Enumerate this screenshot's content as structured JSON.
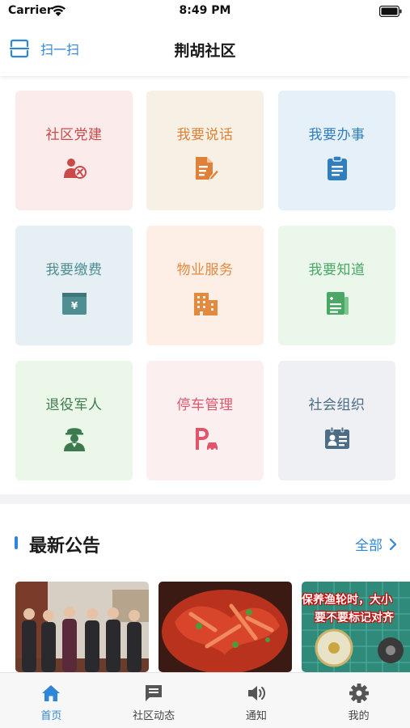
{
  "status_bar": {
    "carrier": "Carrier",
    "time": "8:49 PM"
  },
  "header": {
    "scan_label": "扫一扫",
    "title": "荆胡社区"
  },
  "grid": [
    {
      "label": "社区党建",
      "icon": "party-icon",
      "color": "#c94a4a",
      "bg": "#fbeceb"
    },
    {
      "label": "我要说话",
      "icon": "document-edit-icon",
      "color": "#e0813a",
      "bg": "#f6f1e4"
    },
    {
      "label": "我要办事",
      "icon": "clipboard-icon",
      "color": "#2f7fc0",
      "bg": "#e5f0f8"
    },
    {
      "label": "我要缴费",
      "icon": "payment-box-icon",
      "color": "#4f8e92",
      "bg": "#e5eff4"
    },
    {
      "label": "物业服务",
      "icon": "building-icon",
      "color": "#e28b3f",
      "bg": "#fdeee6"
    },
    {
      "label": "我要知道",
      "icon": "news-icon",
      "color": "#4aa766",
      "bg": "#eaf7ea"
    },
    {
      "label": "退役军人",
      "icon": "soldier-icon",
      "color": "#3e7a4f",
      "bg": "#ebf7e8"
    },
    {
      "label": "停车管理",
      "icon": "parking-icon",
      "color": "#e0556a",
      "bg": "#fbeff0"
    },
    {
      "label": "社会组织",
      "icon": "id-card-icon",
      "color": "#4c6d85",
      "bg": "#eef0f3"
    }
  ],
  "notices": {
    "title": "最新公告",
    "more_label": "全部",
    "items": [
      {
        "caption": ""
      },
      {
        "caption": ""
      },
      {
        "caption": "保养渔轮时，大小\n要不要标记对齐"
      }
    ]
  },
  "tabbar": [
    {
      "label": "首页",
      "icon": "home-icon",
      "active": true
    },
    {
      "label": "社区动态",
      "icon": "message-icon",
      "active": false
    },
    {
      "label": "通知",
      "icon": "speaker-icon",
      "active": false
    },
    {
      "label": "我的",
      "icon": "gear-icon",
      "active": false
    }
  ],
  "colors": {
    "accent": "#2f86d8"
  }
}
